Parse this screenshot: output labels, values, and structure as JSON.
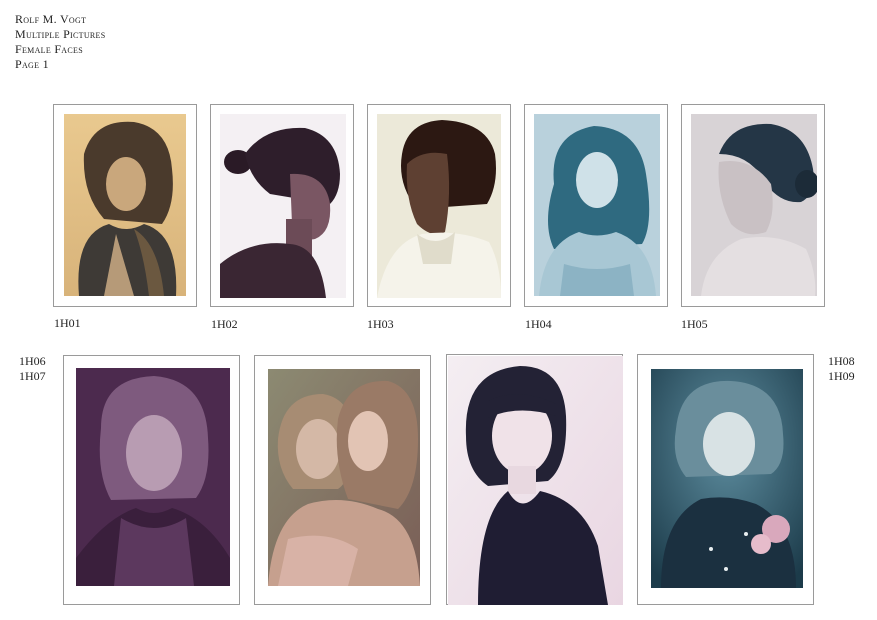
{
  "header": {
    "author": "Rolf M. Vogt",
    "collection": "Multiple Pictures",
    "topic": "Female Faces",
    "page": "Page 1"
  },
  "pictures": [
    {
      "code": "1H01",
      "tone": "sepia"
    },
    {
      "code": "1H02",
      "tone": "plum"
    },
    {
      "code": "1H03",
      "tone": "brown"
    },
    {
      "code": "1H04",
      "tone": "teal"
    },
    {
      "code": "1H05",
      "tone": "grey-blue"
    },
    {
      "code": "1H06",
      "tone": "purple"
    },
    {
      "code": "1H07",
      "tone": "sage-pink"
    },
    {
      "code": "1H08",
      "tone": "pink-navy"
    },
    {
      "code": "1H09",
      "tone": "teal-dark"
    }
  ]
}
